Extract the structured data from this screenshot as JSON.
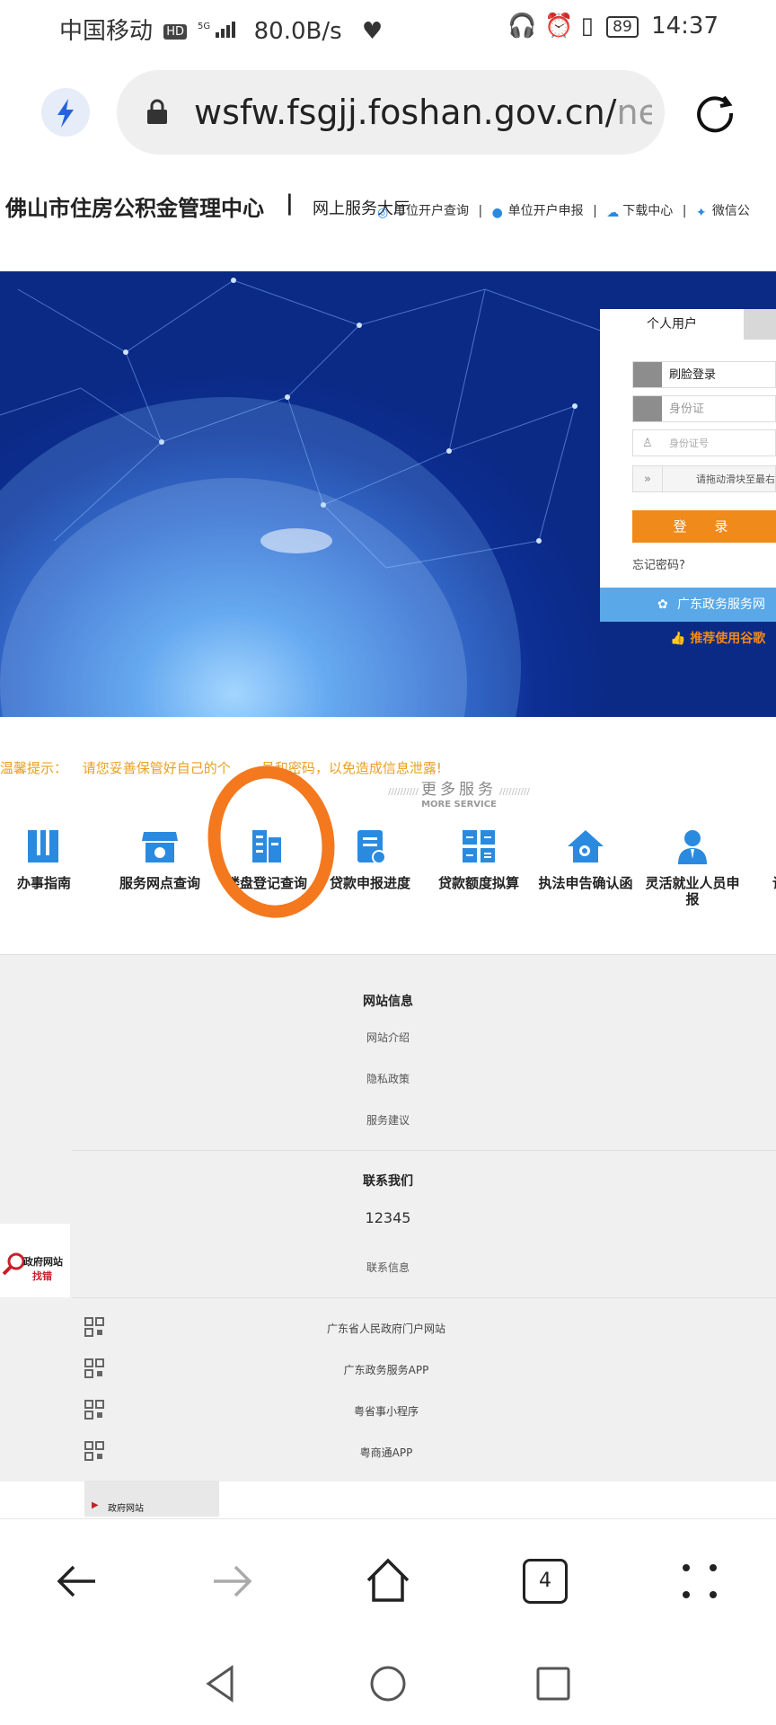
{
  "status_bar": {
    "carrier": "中国移动",
    "hd": "HD",
    "net": "5G",
    "speed": "80.0B/s",
    "battery": "89",
    "time": "14:37"
  },
  "browser": {
    "url_main": "wsfw.fsgjj.foshan.gov.cn/",
    "url_dim": "netfa",
    "tab_count": "4"
  },
  "site": {
    "title": "佛山市住房公积金管理中心",
    "separator": "|",
    "hall": "网上服务大厅",
    "nav": [
      "单位开户查询",
      "单位开户申报",
      "下载中心",
      "微信公"
    ]
  },
  "login": {
    "tab_personal": "个人用户",
    "method": "刷脸登录",
    "id_type": "身份证",
    "id_placeholder": "身份证号",
    "slider_hint": "请拖动滑块至最右",
    "login_button": "登　录",
    "forgot": "忘记密码?",
    "gd_service": "广东政务服务网",
    "recommend": "推荐使用谷歌"
  },
  "tip": {
    "label": "温馨提示：",
    "text_a": "请您妥善保管好自己的个",
    "text_b": "号和密码，以免造成信息泄露!"
  },
  "more_service": {
    "title": "更多服务",
    "subtitle": "MORE SERVICE",
    "items": [
      {
        "label": "办事指南",
        "icon": "book-icon"
      },
      {
        "label": "服务网点查询",
        "icon": "store-icon"
      },
      {
        "label": "楼盘登记查询",
        "icon": "building-icon"
      },
      {
        "label": "贷款申报进度",
        "icon": "loan-progress-icon"
      },
      {
        "label": "贷款额度拟算",
        "icon": "calculator-icon"
      },
      {
        "label": "执法申告确认函",
        "icon": "house-search-icon"
      },
      {
        "label": "灵活就业人员申报",
        "icon": "person-icon"
      },
      {
        "label": "让",
        "icon": "more-icon"
      }
    ]
  },
  "footer": {
    "site_info_title": "网站信息",
    "site_info_links": [
      "网站介绍",
      "隐私政策",
      "服务建议"
    ],
    "contact_title": "联系我们",
    "hotline": "12345",
    "contact_info": "联系信息",
    "qr_links": [
      "广东省人民政府门户网站",
      "广东政务服务APP",
      "粤省事小程序",
      "粤商通APP"
    ],
    "error_badge_line1": "政府网站",
    "error_badge_line2": "找错",
    "error_badge2": "政府网站"
  },
  "colors": {
    "accent_orange": "#f08a1a",
    "annotation_circle": "#f4781e",
    "service_blue": "#2a8ae0",
    "banner_blue": "#0d2f94"
  }
}
